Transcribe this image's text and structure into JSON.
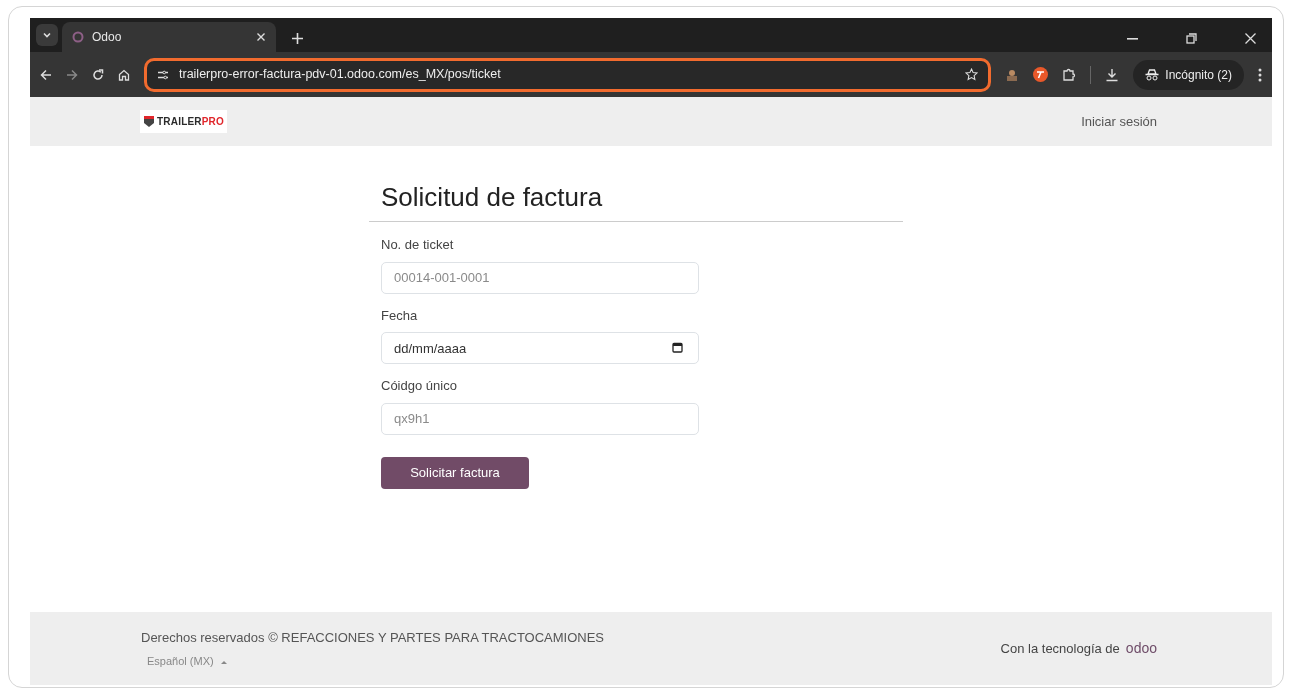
{
  "browser": {
    "tab_title": "Odoo",
    "address": "trailerpro-error-factura-pdv-01.odoo.com/es_MX/pos/ticket",
    "profile": "Incógnito (2)"
  },
  "header": {
    "logo": [
      {
        "text": "TRAILER",
        "color": "#2b2b2b"
      },
      {
        "text": "PRO",
        "color": "#e0262b"
      }
    ],
    "login": "Iniciar sesión"
  },
  "form": {
    "title": "Solicitud de factura",
    "fields": [
      {
        "label": "No. de ticket",
        "kind": "text",
        "placeholder": "00014-001-0001"
      },
      {
        "label": "Fecha",
        "kind": "date",
        "placeholder": "dd/mm/aaaa"
      },
      {
        "label": "Cóidgo único",
        "kind": "text",
        "placeholder": "qx9h1"
      }
    ],
    "submit": "Solicitar factura"
  },
  "footer": {
    "copyright": "Derechos reservados © REFACCIONES Y PARTES PARA TRACTOCAMIONES",
    "language": "Español (MX)",
    "powered_by": "Con la tecnología de",
    "brand": "odoo"
  }
}
